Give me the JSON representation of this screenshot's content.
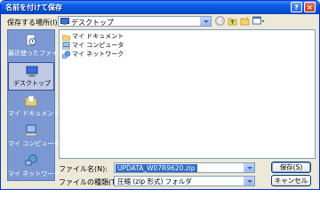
{
  "window": {
    "title": "名前を付けて保存",
    "help_label": "?",
    "close_label": "×"
  },
  "save_in": {
    "label": "保存する場所(I):",
    "value": "デスクトップ"
  },
  "places": [
    {
      "label": "最近使ったファイル",
      "icon": "recent-documents-icon"
    },
    {
      "label": "デスクトップ",
      "icon": "desktop-icon"
    },
    {
      "label": "マイ ドキュメント",
      "icon": "my-documents-icon"
    },
    {
      "label": "マイ コンピュータ",
      "icon": "my-computer-icon"
    },
    {
      "label": "マイ ネットワーク",
      "icon": "my-network-icon"
    }
  ],
  "files": [
    {
      "label": "マイ ドキュメント",
      "icon": "my-documents-icon"
    },
    {
      "label": "マイ コンピュータ",
      "icon": "my-computer-icon"
    },
    {
      "label": "マイ ネットワーク",
      "icon": "my-network-icon"
    }
  ],
  "filename": {
    "label": "ファイル名(N):",
    "value": "UPDATA_W07R9620.zip"
  },
  "filetype": {
    "label": "ファイルの種類(T):",
    "value": "圧縮 (zip 形式) フォルダ"
  },
  "buttons": {
    "save": "保存(S)",
    "cancel": "キャンセル"
  },
  "colors": {
    "titlebar": "#0a5fe3",
    "places_bar": "#7c98d3",
    "dialog_bg": "#ece9d8",
    "selection": "#316ac5"
  }
}
